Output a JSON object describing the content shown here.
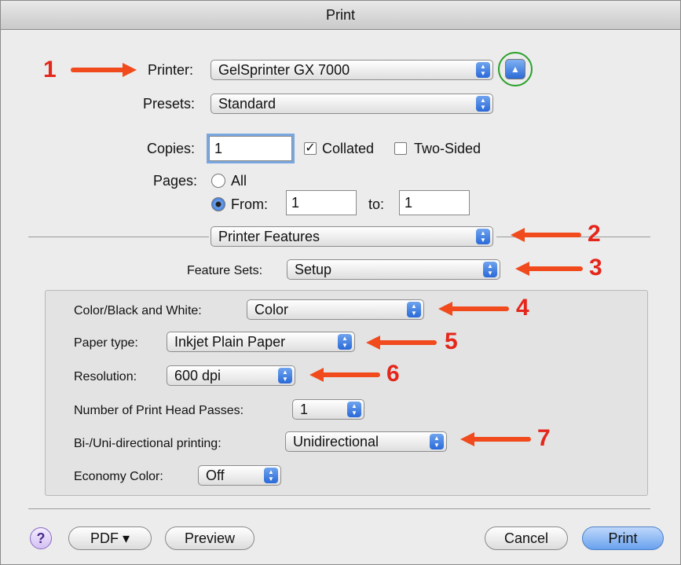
{
  "window": {
    "title": "Print"
  },
  "printer": {
    "label": "Printer:",
    "value": "GelSprinter GX 7000"
  },
  "presets": {
    "label": "Presets:",
    "value": "Standard"
  },
  "copies": {
    "label": "Copies:",
    "value": "1",
    "collated_label": "Collated",
    "collated_checked": true,
    "two_sided_label": "Two-Sided",
    "two_sided_checked": false
  },
  "pages": {
    "label": "Pages:",
    "all_label": "All",
    "from_label": "From:",
    "from_value": "1",
    "to_label": "to:",
    "to_value": "1",
    "selected": "from"
  },
  "section_popup": {
    "value": "Printer Features"
  },
  "feature_sets": {
    "label": "Feature Sets:",
    "value": "Setup"
  },
  "features": {
    "color_bw": {
      "label": "Color/Black and White:",
      "value": "Color"
    },
    "paper_type": {
      "label": "Paper type:",
      "value": "Inkjet Plain Paper"
    },
    "resolution": {
      "label": "Resolution:",
      "value": "600 dpi"
    },
    "head_passes": {
      "label": "Number of Print Head Passes:",
      "value": "1"
    },
    "direction": {
      "label": "Bi-/Uni-directional printing:",
      "value": "Unidirectional"
    },
    "economy": {
      "label": "Economy Color:",
      "value": "Off"
    }
  },
  "buttons": {
    "help": "?",
    "pdf": "PDF ▾",
    "preview": "Preview",
    "cancel": "Cancel",
    "print": "Print"
  },
  "annotations": [
    "1",
    "2",
    "3",
    "4",
    "5",
    "6",
    "7"
  ],
  "colors": {
    "arrow": "#f04a1d",
    "number": "#e5261b",
    "ring": "#2aa12a",
    "accent": "#3b78dc"
  }
}
